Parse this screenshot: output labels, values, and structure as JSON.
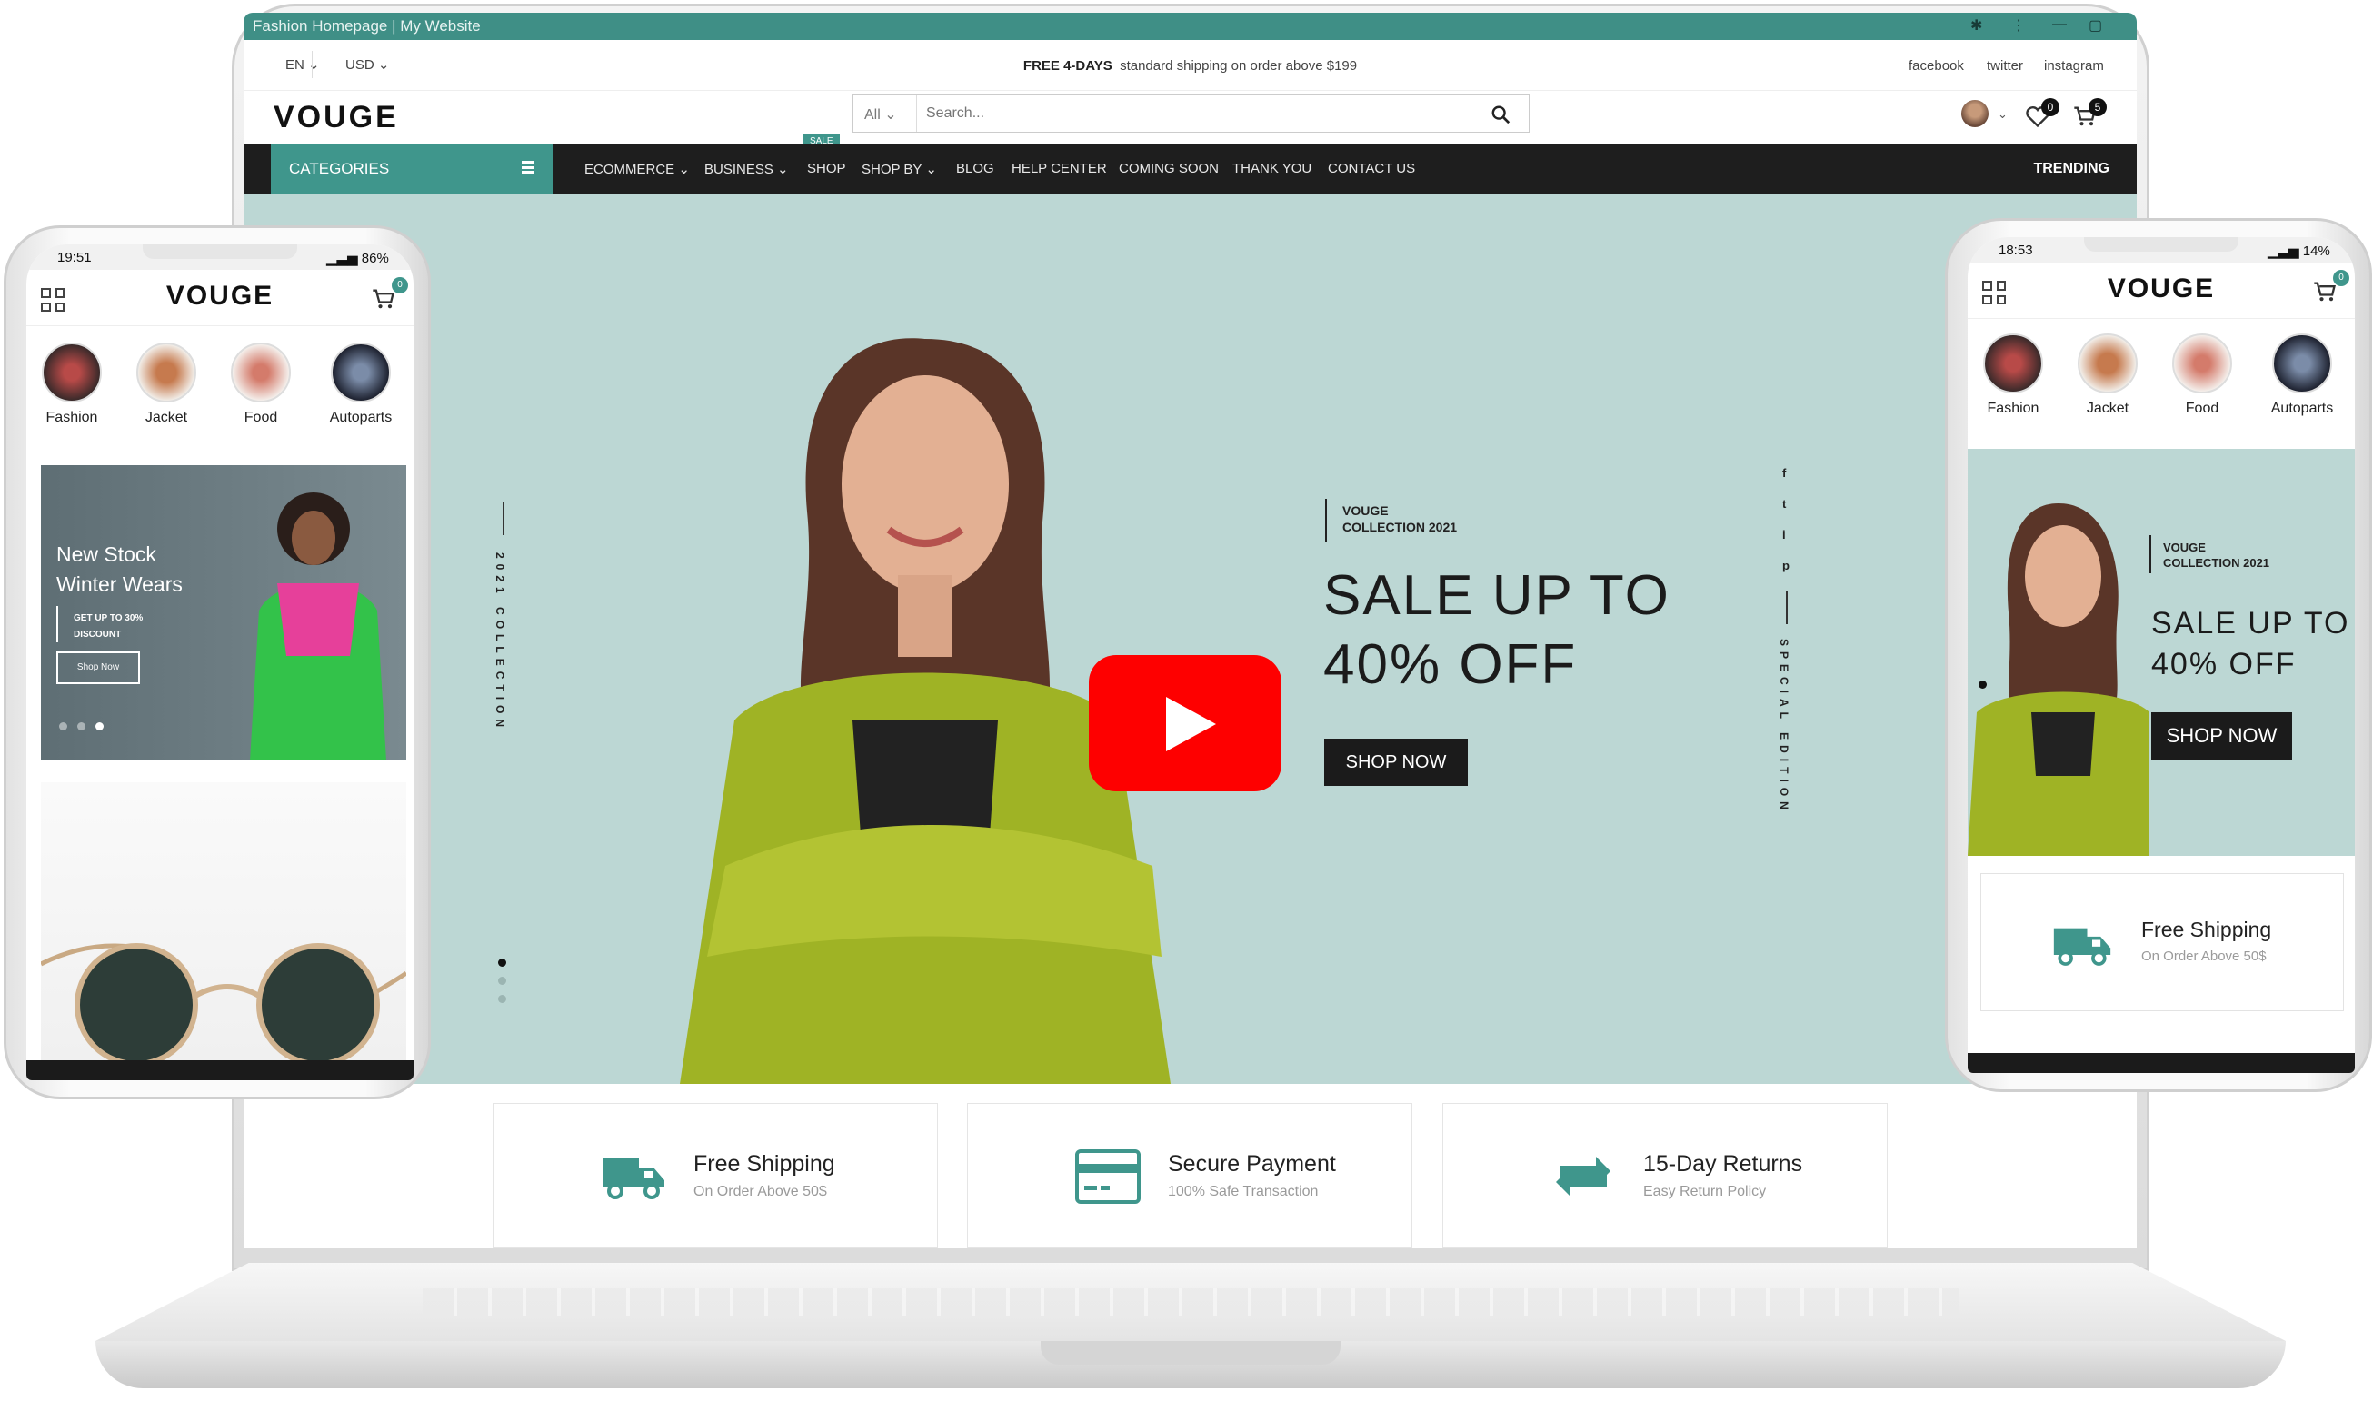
{
  "laptop": {
    "window_title": "Fashion Homepage | My Website",
    "topbar": {
      "language": "EN",
      "currency": "USD",
      "promo_bold": "FREE 4-DAYS",
      "promo_text": "standard shipping on order above $199",
      "social": [
        "facebook",
        "twitter",
        "instagram"
      ]
    },
    "header": {
      "logo": "VOUGE",
      "search_category": "All",
      "search_placeholder": "Search...",
      "wishlist_count": "0",
      "cart_count": "5"
    },
    "nav": {
      "categories_label": "CATEGORIES",
      "items": [
        "ECOMMERCE",
        "BUSINESS",
        "SHOP",
        "SHOP BY",
        "BLOG",
        "HELP CENTER",
        "COMING SOON",
        "THANK YOU",
        "CONTACT US"
      ],
      "sale_tag": "SALE",
      "trending": "TRENDING"
    },
    "hero": {
      "vertical_left": "2021 COLLECTION",
      "vertical_right": "SPECIAL EDITION",
      "tagline_line1": "VOUGE",
      "tagline_line2": "COLLECTION 2021",
      "headline_line1": "SALE UP TO",
      "headline_line2": "40% OFF",
      "button": "SHOP NOW",
      "social_icons": [
        "f",
        "t",
        "i",
        "p"
      ]
    },
    "features": [
      {
        "title": "Free Shipping",
        "subtitle": "On Order Above 50$",
        "icon": "truck-icon"
      },
      {
        "title": "Secure Payment",
        "subtitle": "100% Safe Transaction",
        "icon": "credit-card-icon"
      },
      {
        "title": "15-Day Returns",
        "subtitle": "Easy Return Policy",
        "icon": "return-icon"
      }
    ]
  },
  "left_phone": {
    "time": "19:51",
    "battery": "86%",
    "logo": "VOUGE",
    "cart_count": "0",
    "categories": [
      "Fashion",
      "Jacket",
      "Food",
      "Autoparts"
    ],
    "banner": {
      "title_line1": "New Stock",
      "title_line2": "Winter Wears",
      "sub_line1": "GET UP TO 30%",
      "sub_line2": "DISCOUNT",
      "button": "Shop Now"
    }
  },
  "right_phone": {
    "time": "18:53",
    "battery": "14%",
    "logo": "VOUGE",
    "cart_count": "0",
    "categories": [
      "Fashion",
      "Jacket",
      "Food",
      "Autoparts"
    ],
    "banner": {
      "tagline_line1": "VOUGE",
      "tagline_line2": "COLLECTION 2021",
      "headline_line1": "SALE UP TO",
      "headline_line2": "40% OFF",
      "button": "SHOP NOW"
    },
    "feature": {
      "title": "Free Shipping",
      "subtitle": "On Order Above 50$"
    }
  },
  "colors": {
    "accent": "#3f968c",
    "hero_bg": "#bcd7d4",
    "nav_bg": "#1e1e1e",
    "youtube_red": "#fe0000"
  }
}
